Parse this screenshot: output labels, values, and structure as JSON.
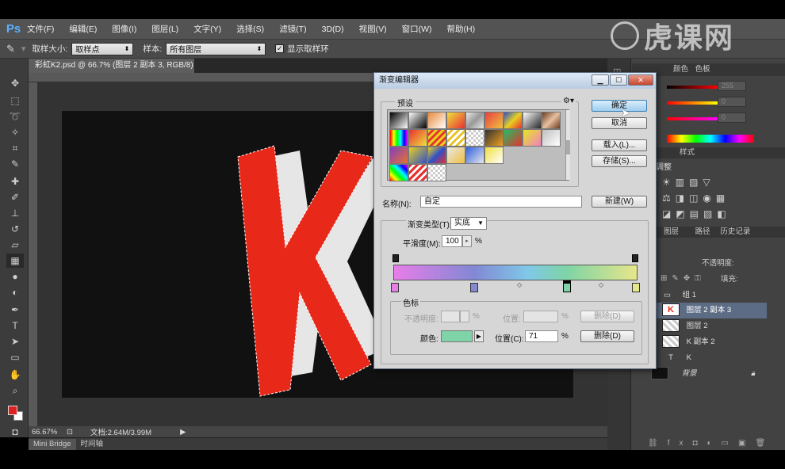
{
  "app": {
    "logo": "Ps"
  },
  "menu": [
    "文件(F)",
    "编辑(E)",
    "图像(I)",
    "图层(L)",
    "文字(Y)",
    "选择(S)",
    "滤镜(T)",
    "3D(D)",
    "视图(V)",
    "窗口(W)",
    "帮助(H)"
  ],
  "options_bar": {
    "sample_size_label": "取样大小:",
    "sample_size_value": "取样点",
    "sample_label": "样本:",
    "sample_value": "所有图层",
    "show_ring_label": "显示取样环",
    "show_ring_checked": "✓"
  },
  "document": {
    "tab_title": "彩虹K2.psd @ 66.7% (图层 2 副本 3, RGB/8) *",
    "close": "×",
    "zoom": "66.67%",
    "doc_size": "文档:2.64M/3.99M",
    "canvas_letter": "K"
  },
  "bottom_tabs": [
    "Mini Bridge",
    "时间轴"
  ],
  "colors": {
    "foreground": "#e02020",
    "background": "#ffffff",
    "k_red": "#e8291a",
    "k_shadow": "#e6e6e6"
  },
  "watermark": "虎课网",
  "right_panel": {
    "panel_tabs_1": [
      "颜色",
      "色板"
    ],
    "color_values": [
      "255",
      "0",
      "0"
    ],
    "adjustments_title": "调整",
    "styles_tab": "样式",
    "layer_tabs": [
      "图层",
      "通道",
      "路径",
      "历史记录"
    ],
    "opacity_label": "不透明度:",
    "fill_label": "填充:",
    "layers": [
      {
        "name": "组 1",
        "kind": "group"
      },
      {
        "name": "图层 2 副本 3",
        "kind": "layer",
        "selected": true
      },
      {
        "name": "图层 2",
        "kind": "layer"
      },
      {
        "name": "K 副本 2",
        "kind": "text"
      },
      {
        "name": "K",
        "kind": "text"
      },
      {
        "name": "背景",
        "kind": "background"
      }
    ]
  },
  "gradient_editor": {
    "title": "渐变编辑器",
    "presets_label": "预设",
    "ok": "确定",
    "cancel": "取消",
    "load": "载入(L)...",
    "save": "存储(S)...",
    "name_label": "名称(N):",
    "name_value": "自定",
    "new_button": "新建(W)",
    "gradient_type_label": "渐变类型(T):",
    "gradient_type_value": "实底",
    "smoothness_label": "平滑度(M):",
    "smoothness_value": "100",
    "percent": "%",
    "stops_group_label": "色标",
    "opacity_label": "不透明度:",
    "location_label_top": "位置:",
    "delete_top": "删除(D)",
    "color_label": "颜色:",
    "color_swatch": "#7ed4a6",
    "location_label": "位置(C):",
    "location_value": "71",
    "delete": "删除(D)",
    "gradient_stops": [
      "#e77ee8",
      "#8288d4",
      "#80c8e8",
      "#7ed4a6",
      "#e6e68a"
    ],
    "preset_rows": [
      [
        "#c8c8c8",
        "#1a1a1a",
        "#3c3c3c",
        "#e88a3c",
        "#e8e8e8",
        "#e84040",
        "#3050c8",
        "#282828",
        "#c87050"
      ],
      [
        "#e8d020",
        "#e83030",
        "#ffffff",
        "#e8c020",
        "#c8c8c8",
        "#303030",
        "#20c060",
        "#e8e820",
        "#e8e8e8"
      ],
      [
        "#8040c0",
        "#e8d020",
        "#d0d0d0",
        "#e8e8e8",
        "#e8e8e8"
      ]
    ]
  }
}
